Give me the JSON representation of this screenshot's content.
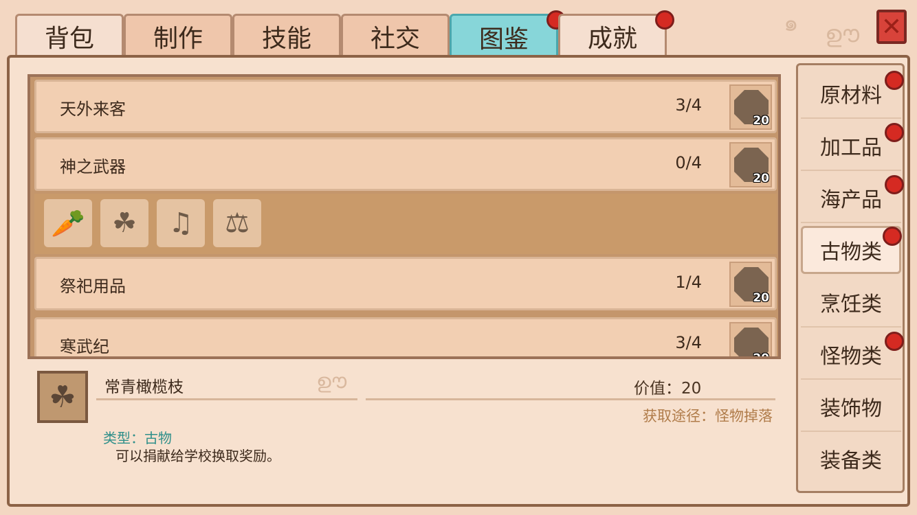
{
  "tabs": [
    {
      "label": "背包",
      "active": false,
      "badge": false
    },
    {
      "label": "制作",
      "active": false,
      "badge": false
    },
    {
      "label": "技能",
      "active": false,
      "badge": false
    },
    {
      "label": "社交",
      "active": false,
      "badge": false
    },
    {
      "label": "图鉴",
      "active": true,
      "badge": true
    },
    {
      "label": "成就",
      "active": false,
      "badge": true
    }
  ],
  "close_icon": "close-x-icon",
  "collections": [
    {
      "name": "天外来客",
      "count": "3/4",
      "reward": "20"
    },
    {
      "name": "神之武器",
      "count": "0/4",
      "reward": "20"
    },
    {
      "name": "祭祀用品",
      "count": "1/4",
      "reward": "20"
    },
    {
      "name": "寒武纪",
      "count": "3/4",
      "reward": "20"
    }
  ],
  "expanded_items": [
    {
      "icon": "carrot-silhouette-icon"
    },
    {
      "icon": "olive-branch-silhouette-icon"
    },
    {
      "icon": "lyre-silhouette-icon"
    },
    {
      "icon": "scale-silhouette-icon"
    }
  ],
  "categories": [
    {
      "label": "原材料",
      "badge": true,
      "active": false
    },
    {
      "label": "加工品",
      "badge": true,
      "active": false
    },
    {
      "label": "海产品",
      "badge": true,
      "active": false
    },
    {
      "label": "古物类",
      "badge": true,
      "active": true
    },
    {
      "label": "烹饪类",
      "badge": false,
      "active": false
    },
    {
      "label": "怪物类",
      "badge": true,
      "active": false
    },
    {
      "label": "装饰物",
      "badge": false,
      "active": false
    },
    {
      "label": "装备类",
      "badge": false,
      "active": false
    }
  ],
  "detail": {
    "name": "常青橄榄枝",
    "value": "价值：20",
    "source": "获取途径：怪物掉落",
    "type": "类型：古物",
    "description": "可以捐献给学校换取奖励。",
    "icon": "olive-branch-silhouette-icon"
  },
  "colors": {
    "active_tab": "#87d6d9",
    "badge": "#d52a22",
    "accent_teal": "#3fa29d"
  }
}
